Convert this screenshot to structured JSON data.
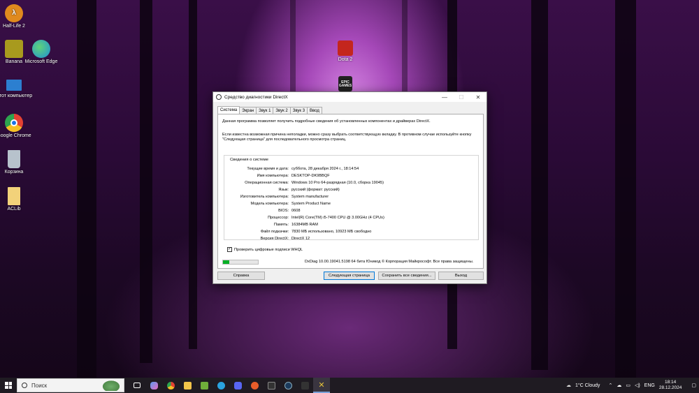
{
  "desktop": {
    "icons": [
      {
        "label": "Half-Life 2",
        "icon": "half-life-icon",
        "color": "#e08a1e"
      },
      {
        "label": "Banana",
        "icon": "banana-icon",
        "color": "#a89a1e"
      },
      {
        "label": "Microsoft Edge",
        "icon": "edge-icon",
        "color": "#1f8fd6"
      },
      {
        "label": "Этот компьютер",
        "icon": "computer-icon",
        "color": "#2c7fd0"
      },
      {
        "label": "Google Chrome",
        "icon": "chrome-icon",
        "color": "#e34133"
      },
      {
        "label": "Корзина",
        "icon": "recycle-bin-icon",
        "color": "#b7c2cc"
      },
      {
        "label": "ACLib",
        "icon": "file-icon",
        "color": "#f2d27a"
      },
      {
        "label": "Dota 2",
        "icon": "dota-icon",
        "color": "#c4261d"
      },
      {
        "label": "EPIC GAMES",
        "icon": "epic-games-icon",
        "color": "#222222"
      }
    ]
  },
  "dialog": {
    "title": "Средство диагностики DirectX",
    "tabs": [
      "Система",
      "Экран",
      "Звук 1",
      "Звук 2",
      "Звук 3",
      "Ввод"
    ],
    "intro1": "Данная программа позволяет получить подробные сведения об установленных компонентах и драйверах DirectX.",
    "intro2": "Если известна возможная причина неполадки, можно сразу выбрать соответствующую вкладку. В противном случае используйте кнопку \"Следующая страница\" для последовательного просмотра страниц.",
    "group_title": "Сведения о системе",
    "rows": [
      {
        "label": "Текущие время и дата:",
        "value": "суббота, 28 декабря 2024 г., 18:14:54"
      },
      {
        "label": "Имя компьютера:",
        "value": "DESKTOP-DK9BBQF"
      },
      {
        "label": "Операционная система:",
        "value": "Windows 10 Pro 64-разрядная (10.0, сборка 19045)"
      },
      {
        "label": "Язык:",
        "value": "русский (формат: русский)"
      },
      {
        "label": "Изготовитель компьютера:",
        "value": "System manufacturer"
      },
      {
        "label": "Модель компьютера:",
        "value": "System Product Name"
      },
      {
        "label": "BIOS:",
        "value": "0608"
      },
      {
        "label": "Процессор:",
        "value": "Intel(R) Core(TM) i5-7400 CPU @ 3.00GHz (4 CPUs)"
      },
      {
        "label": "Память:",
        "value": "16384MB RAM"
      },
      {
        "label": "Файл подкачки:",
        "value": "7830 МБ использовано, 10923 МБ свободно"
      },
      {
        "label": "Версия DirectX:",
        "value": "DirectX 12"
      }
    ],
    "whql_label": "Проверить цифровые подписи WHQL",
    "whql_checked": "✓",
    "progress_fraction": 0.18,
    "footer_note": "DxDiag 10.00.19041.5198 64 бита Юникод © Корпорация Майкрософт. Все права защищены.",
    "buttons": {
      "help": "Справка",
      "next": "Следующая страница",
      "save": "Сохранить все сведения...",
      "exit": "Выход"
    }
  },
  "taskbar": {
    "search_placeholder": "Поиск",
    "apps": [
      {
        "icon": "task-view-icon",
        "color": "#ffffff"
      },
      {
        "icon": "copilot-icon",
        "color": "#5a9cf0"
      },
      {
        "icon": "chrome-icon",
        "color": "#e34133"
      },
      {
        "icon": "file-explorer-icon",
        "color": "#f2c54a"
      },
      {
        "icon": "minecraft-icon",
        "color": "#6fae3a"
      },
      {
        "icon": "telegram-icon",
        "color": "#2aa3df"
      },
      {
        "icon": "discord-icon",
        "color": "#5865f2"
      },
      {
        "icon": "app-orange-icon",
        "color": "#e85d2a"
      },
      {
        "icon": "epic-games-icon",
        "color": "#333333"
      },
      {
        "icon": "steam-icon",
        "color": "#1b3a5c"
      },
      {
        "icon": "dark-app-icon",
        "color": "#333333"
      },
      {
        "icon": "directx-icon",
        "color": "#e3c23a"
      }
    ],
    "weather": "1°C  Cloudy",
    "lang": "ENG",
    "time": "18:14",
    "date": "28.12.2024"
  }
}
